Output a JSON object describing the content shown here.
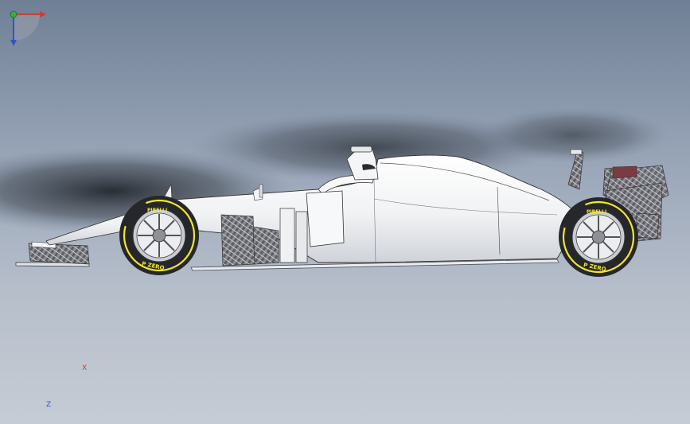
{
  "viewport": {
    "background_top": "#6f7f95",
    "background_bottom": "#c6ccd5"
  },
  "model": {
    "tire_brand": "PIRELLI",
    "tire_compound": "P ZERO",
    "tire_stripe_color": "#f3e62a",
    "carbon_color": "#6d6f74"
  },
  "triad": {
    "x_label": "X",
    "z_label": "Z",
    "x_color": "#d93a2a",
    "y_color": "#35b03a",
    "z_color": "#2e55c9"
  }
}
